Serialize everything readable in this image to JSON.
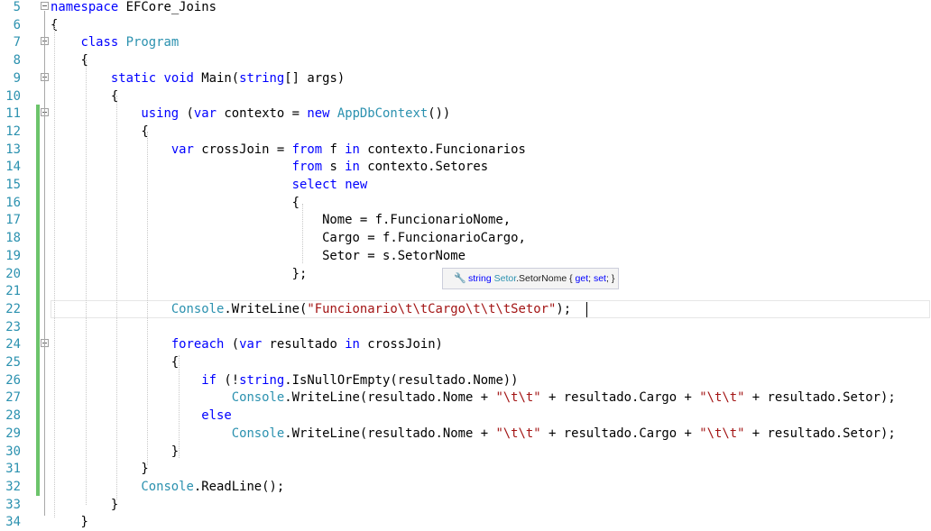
{
  "editor": {
    "language": "C#",
    "lines": [
      {
        "num": "5",
        "tokens": [
          {
            "t": "namespace",
            "c": "kw"
          },
          {
            "t": " EFCore_Joins",
            "c": ""
          }
        ]
      },
      {
        "num": "6",
        "tokens": [
          {
            "t": "{",
            "c": ""
          }
        ]
      },
      {
        "num": "7",
        "tokens": [
          {
            "t": "    ",
            "c": ""
          },
          {
            "t": "class",
            "c": "kw"
          },
          {
            "t": " ",
            "c": ""
          },
          {
            "t": "Program",
            "c": "ty"
          }
        ]
      },
      {
        "num": "8",
        "tokens": [
          {
            "t": "    {",
            "c": ""
          }
        ]
      },
      {
        "num": "9",
        "tokens": [
          {
            "t": "        ",
            "c": ""
          },
          {
            "t": "static",
            "c": "kw"
          },
          {
            "t": " ",
            "c": ""
          },
          {
            "t": "void",
            "c": "kw"
          },
          {
            "t": " Main(",
            "c": ""
          },
          {
            "t": "string",
            "c": "kw"
          },
          {
            "t": "[] args)",
            "c": ""
          }
        ]
      },
      {
        "num": "10",
        "tokens": [
          {
            "t": "        {",
            "c": ""
          }
        ]
      },
      {
        "num": "11",
        "tokens": [
          {
            "t": "            ",
            "c": ""
          },
          {
            "t": "using",
            "c": "kw"
          },
          {
            "t": " (",
            "c": ""
          },
          {
            "t": "var",
            "c": "kw"
          },
          {
            "t": " contexto = ",
            "c": ""
          },
          {
            "t": "new",
            "c": "kw"
          },
          {
            "t": " ",
            "c": ""
          },
          {
            "t": "AppDbContext",
            "c": "ty"
          },
          {
            "t": "())",
            "c": ""
          }
        ]
      },
      {
        "num": "12",
        "tokens": [
          {
            "t": "            {",
            "c": ""
          }
        ]
      },
      {
        "num": "13",
        "tokens": [
          {
            "t": "                ",
            "c": ""
          },
          {
            "t": "var",
            "c": "kw"
          },
          {
            "t": " crossJoin = ",
            "c": ""
          },
          {
            "t": "from",
            "c": "kw"
          },
          {
            "t": " f ",
            "c": ""
          },
          {
            "t": "in",
            "c": "kw"
          },
          {
            "t": " contexto.Funcionarios",
            "c": ""
          }
        ]
      },
      {
        "num": "14",
        "tokens": [
          {
            "t": "                                ",
            "c": ""
          },
          {
            "t": "from",
            "c": "kw"
          },
          {
            "t": " s ",
            "c": ""
          },
          {
            "t": "in",
            "c": "kw"
          },
          {
            "t": " contexto.Setores",
            "c": ""
          }
        ]
      },
      {
        "num": "15",
        "tokens": [
          {
            "t": "                                ",
            "c": ""
          },
          {
            "t": "select",
            "c": "kw"
          },
          {
            "t": " ",
            "c": ""
          },
          {
            "t": "new",
            "c": "kw"
          }
        ]
      },
      {
        "num": "16",
        "tokens": [
          {
            "t": "                                {",
            "c": ""
          }
        ]
      },
      {
        "num": "17",
        "tokens": [
          {
            "t": "                                    Nome = f.FuncionarioNome,",
            "c": ""
          }
        ]
      },
      {
        "num": "18",
        "tokens": [
          {
            "t": "                                    Cargo = f.FuncionarioCargo,",
            "c": ""
          }
        ]
      },
      {
        "num": "19",
        "tokens": [
          {
            "t": "                                    Setor = s.SetorNome",
            "c": ""
          }
        ]
      },
      {
        "num": "20",
        "tokens": [
          {
            "t": "                                };",
            "c": ""
          }
        ]
      },
      {
        "num": "21",
        "tokens": []
      },
      {
        "num": "22",
        "tokens": [
          {
            "t": "                ",
            "c": ""
          },
          {
            "t": "Console",
            "c": "ty"
          },
          {
            "t": ".WriteLine(",
            "c": ""
          },
          {
            "t": "\"Funcionario\\t\\tCargo\\t\\t\\tSetor\"",
            "c": "st"
          },
          {
            "t": ");",
            "c": ""
          }
        ]
      },
      {
        "num": "23",
        "tokens": []
      },
      {
        "num": "24",
        "tokens": [
          {
            "t": "                ",
            "c": ""
          },
          {
            "t": "foreach",
            "c": "kw"
          },
          {
            "t": " (",
            "c": ""
          },
          {
            "t": "var",
            "c": "kw"
          },
          {
            "t": " resultado ",
            "c": ""
          },
          {
            "t": "in",
            "c": "kw"
          },
          {
            "t": " crossJoin)",
            "c": ""
          }
        ]
      },
      {
        "num": "25",
        "tokens": [
          {
            "t": "                {",
            "c": ""
          }
        ]
      },
      {
        "num": "26",
        "tokens": [
          {
            "t": "                    ",
            "c": ""
          },
          {
            "t": "if",
            "c": "kw"
          },
          {
            "t": " (!",
            "c": ""
          },
          {
            "t": "string",
            "c": "kw"
          },
          {
            "t": ".IsNullOrEmpty(resultado.Nome))",
            "c": ""
          }
        ]
      },
      {
        "num": "27",
        "tokens": [
          {
            "t": "                        ",
            "c": ""
          },
          {
            "t": "Console",
            "c": "ty"
          },
          {
            "t": ".WriteLine(resultado.Nome + ",
            "c": ""
          },
          {
            "t": "\"\\t\\t\"",
            "c": "st"
          },
          {
            "t": " + resultado.Cargo + ",
            "c": ""
          },
          {
            "t": "\"\\t\\t\"",
            "c": "st"
          },
          {
            "t": " + resultado.Setor);",
            "c": ""
          }
        ]
      },
      {
        "num": "28",
        "tokens": [
          {
            "t": "                    ",
            "c": ""
          },
          {
            "t": "else",
            "c": "kw"
          }
        ]
      },
      {
        "num": "29",
        "tokens": [
          {
            "t": "                        ",
            "c": ""
          },
          {
            "t": "Console",
            "c": "ty"
          },
          {
            "t": ".WriteLine(resultado.Nome + ",
            "c": ""
          },
          {
            "t": "\"\\t\\t\"",
            "c": "st"
          },
          {
            "t": " + resultado.Cargo + ",
            "c": ""
          },
          {
            "t": "\"\\t\\t\"",
            "c": "st"
          },
          {
            "t": " + resultado.Setor);",
            "c": ""
          }
        ]
      },
      {
        "num": "30",
        "tokens": [
          {
            "t": "                }",
            "c": ""
          }
        ]
      },
      {
        "num": "31",
        "tokens": [
          {
            "t": "            }",
            "c": ""
          }
        ]
      },
      {
        "num": "32",
        "tokens": [
          {
            "t": "            ",
            "c": ""
          },
          {
            "t": "Console",
            "c": "ty"
          },
          {
            "t": ".ReadLine();",
            "c": ""
          }
        ]
      },
      {
        "num": "33",
        "tokens": [
          {
            "t": "        }",
            "c": ""
          }
        ]
      },
      {
        "num": "34",
        "tokens": [
          {
            "t": "    }",
            "c": ""
          }
        ]
      }
    ],
    "changed_lines": [
      "11",
      "12",
      "13",
      "14",
      "15",
      "16",
      "17",
      "18",
      "19",
      "20",
      "21",
      "22",
      "23",
      "24",
      "25",
      "26",
      "27",
      "28",
      "29",
      "30",
      "31",
      "32"
    ],
    "fold_markers": [
      "5",
      "7",
      "9",
      "11",
      "24"
    ],
    "current_line": "22"
  },
  "tooltip": {
    "icon": "wrench-icon",
    "type_keyword": "string",
    "class_name": "Setor",
    "member": ".SetorNome",
    "brace_open": " { ",
    "get_kw": "get",
    "semi1": "; ",
    "set_kw": "set",
    "semi2": "; }"
  },
  "colors": {
    "keyword": "#0000ff",
    "type": "#2b91af",
    "string": "#a31515",
    "line_number": "#2b91af",
    "change_bar": "#6cc46b"
  }
}
